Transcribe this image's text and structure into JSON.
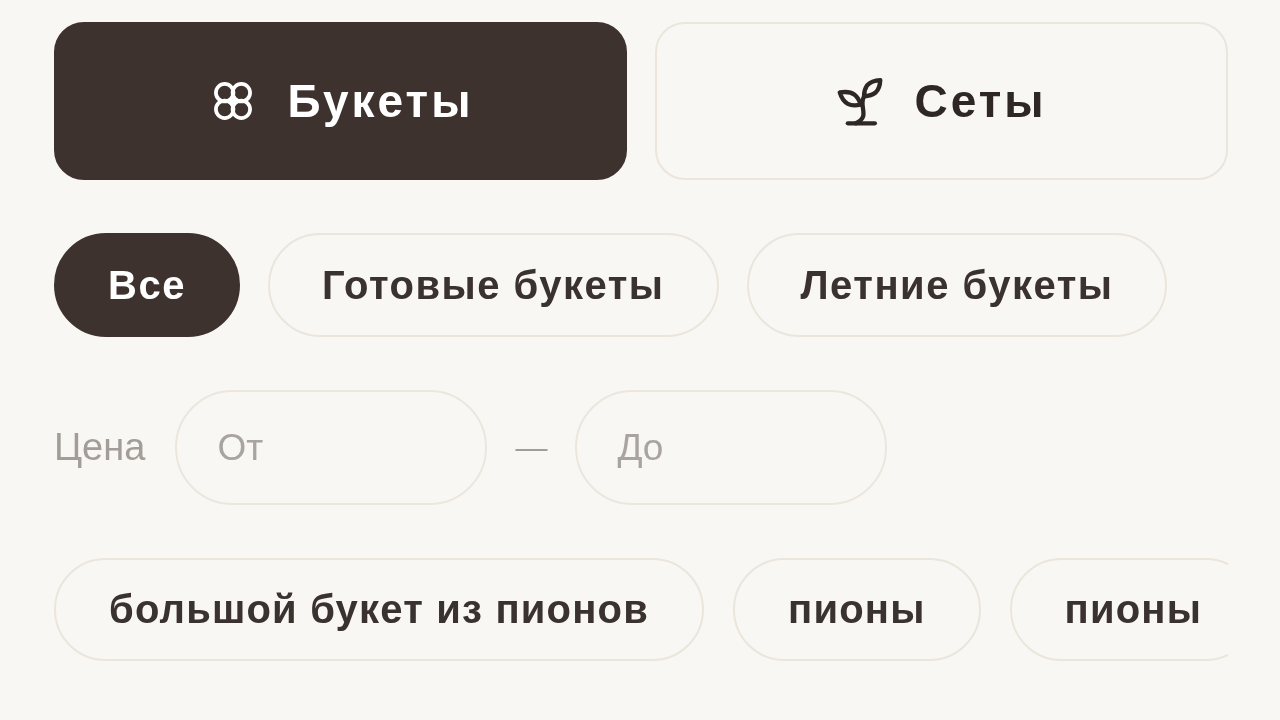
{
  "category_tabs": [
    {
      "label": "Букеты",
      "selected": true
    },
    {
      "label": "Сеты",
      "selected": false
    }
  ],
  "filter_chips": [
    {
      "label": "Все",
      "selected": true
    },
    {
      "label": "Готовые букеты",
      "selected": false
    },
    {
      "label": "Летние букеты",
      "selected": false
    }
  ],
  "price_filter": {
    "label": "Цена",
    "from_field": {
      "placeholder": "От"
    },
    "separator": "—",
    "to_field": {
      "placeholder": "До"
    }
  },
  "suggestion_tags": [
    "большой букет из пионов",
    "пионы",
    "пионы"
  ]
}
